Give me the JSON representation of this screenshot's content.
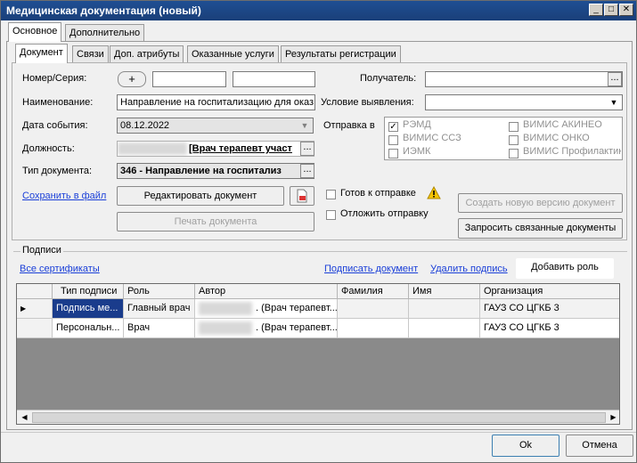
{
  "window": {
    "title": "Медицинская документация (новый)"
  },
  "outer_tabs": [
    "Основное",
    "Дополнительно"
  ],
  "inner_tabs": [
    "Документ",
    "Связи",
    "Доп. атрибуты",
    "Оказанные услуги",
    "Результаты регистрации"
  ],
  "form": {
    "number_label": "Номер/Серия:",
    "number_add": "+",
    "name_label": "Наименование:",
    "name_value": "Направление на госпитализацию для оказ",
    "event_date_label": "Дата события:",
    "event_date_value": "08.12.2022",
    "position_label": "Должность:",
    "position_value": "[Врач терапевт участ",
    "doctype_label": "Тип документа:",
    "doctype_value": "346 - Направление на госпитализ",
    "save_link": "Сохранить в файл",
    "edit_button": "Редактировать документ",
    "print_button": "Печать документа",
    "recipient_label": "Получатель:",
    "condition_label": "Условие выявления:",
    "send_to_label": "Отправка в",
    "send_targets": [
      {
        "label": "РЭМД",
        "checked": true
      },
      {
        "label": "ВИМИС ССЗ",
        "checked": false
      },
      {
        "label": "ИЭМК",
        "checked": false
      },
      {
        "label": "ВИМИС АКИНЕО",
        "checked": false
      },
      {
        "label": "ВИМИС ОНКО",
        "checked": false
      },
      {
        "label": "ВИМИС Профилактик",
        "checked": false
      }
    ],
    "ready_label": "Готов к отправке",
    "postpone_label": "Отложить отправку",
    "new_version_button": "Создать новую версию документ",
    "request_related_button": "Запросить связанные документы"
  },
  "signatures": {
    "group_label": "Подписи",
    "all_certs_link": "Все сертификаты",
    "sign_link": "Подписать документ",
    "delete_sign_link": "Удалить подпись",
    "add_role_button": "Добавить роль",
    "columns": [
      "Тип подписи",
      "Роль",
      "Автор",
      "Фамилия",
      "Имя",
      "Организация"
    ],
    "rows": [
      {
        "type": "Подпись ме...",
        "role": "Главный врач",
        "author": ". (Врач терапевт...",
        "surname": "",
        "name": "",
        "org": "ГАУЗ СО ЦГКБ 3"
      },
      {
        "type": "Персональн...",
        "role": "Врач",
        "author": ". (Врач терапевт...",
        "surname": "",
        "name": "",
        "org": "ГАУЗ СО ЦГКБ 3"
      }
    ]
  },
  "footer": {
    "ok": "Ok",
    "cancel": "Отмена"
  }
}
